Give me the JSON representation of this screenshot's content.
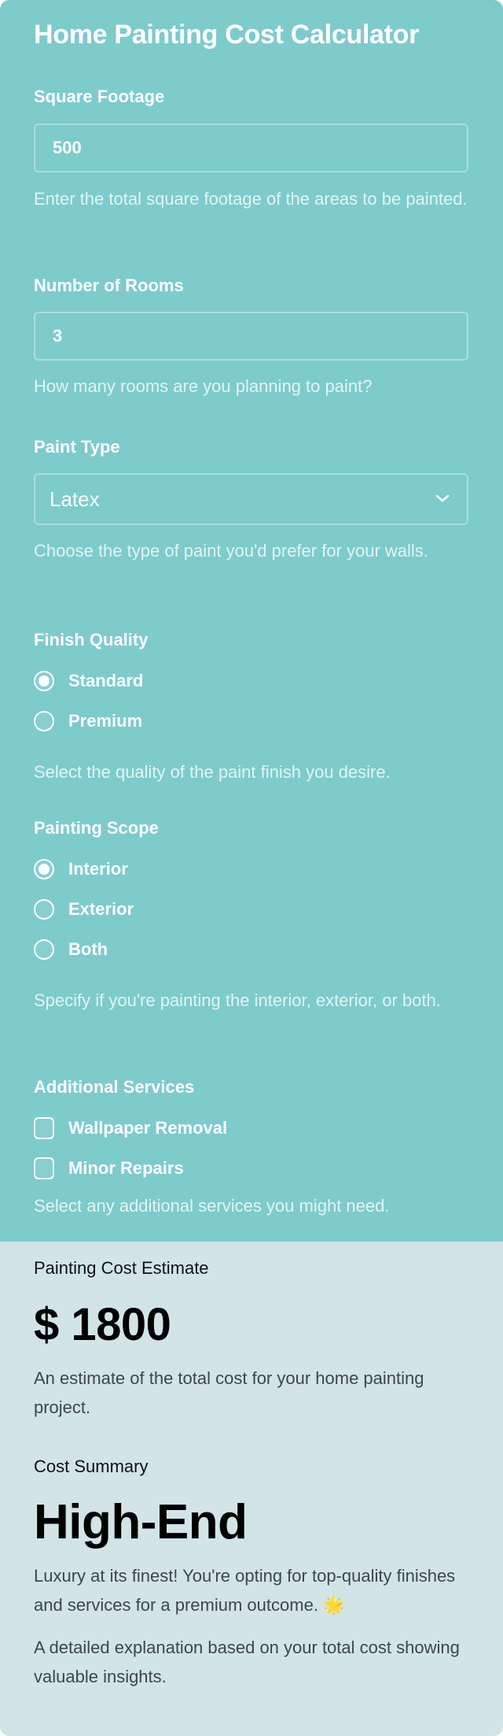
{
  "title": "Home Painting Cost Calculator",
  "colors": {
    "form_background": "#7ecbcc",
    "result_background": "#d3e4e7",
    "form_text": "#ffffff",
    "emoji_accent": "#e8c46a"
  },
  "fields": {
    "square_footage": {
      "label": "Square Footage",
      "value": "500",
      "help": "Enter the total square footage of the areas to be painted."
    },
    "rooms": {
      "label": "Number of Rooms",
      "value": "3",
      "help": "How many rooms are you planning to paint?"
    },
    "paint_type": {
      "label": "Paint Type",
      "selected": "Latex",
      "icon": "chevron-down-icon",
      "help": "Choose the type of paint you'd prefer for your walls."
    },
    "finish_quality": {
      "label": "Finish Quality",
      "options": [
        {
          "label": "Standard",
          "checked": true
        },
        {
          "label": "Premium",
          "checked": false
        }
      ],
      "help": "Select the quality of the paint finish you desire."
    },
    "painting_scope": {
      "label": "Painting Scope",
      "options": [
        {
          "label": "Interior",
          "checked": true
        },
        {
          "label": "Exterior",
          "checked": false
        },
        {
          "label": "Both",
          "checked": false
        }
      ],
      "help": "Specify if you're painting the interior, exterior, or both."
    },
    "additional_services": {
      "label": "Additional Services",
      "options": [
        {
          "label": "Wallpaper Removal",
          "checked": false
        },
        {
          "label": "Minor Repairs",
          "checked": false
        }
      ],
      "help": "Select any additional services you might need."
    }
  },
  "result": {
    "estimate_label": "Painting Cost Estimate",
    "estimate_value": "$ 1800",
    "estimate_help": "An estimate of the total cost for your home painting project.",
    "summary_label": "Cost Summary",
    "summary_value": "High-End",
    "summary_text": "Luxury at its finest! You're opting for top-quality finishes and services for a premium outcome.",
    "summary_emoji": "🌟",
    "summary_help": "A detailed explanation based on your total cost showing valuable insights."
  }
}
